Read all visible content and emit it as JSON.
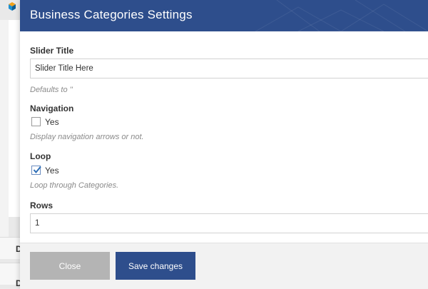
{
  "background": {
    "letters": [
      "D",
      "D"
    ]
  },
  "modal": {
    "title": "Business Categories Settings",
    "fields": {
      "slider_title": {
        "label": "Slider Title",
        "value": "Slider Title Here",
        "help": "Defaults to ''"
      },
      "navigation": {
        "label": "Navigation",
        "checkbox_label": "Yes",
        "checked": false,
        "help": "Display navigation arrows or not."
      },
      "loop": {
        "label": "Loop",
        "checkbox_label": "Yes",
        "checked": true,
        "help": "Loop through Categories."
      },
      "rows": {
        "label": "Rows",
        "value": "1"
      }
    },
    "footer": {
      "close_label": "Close",
      "save_label": "Save changes"
    }
  },
  "colors": {
    "header": "#2e4e8c",
    "primary_button": "#2e4e8c",
    "secondary_button": "#b4b4b4",
    "checkbox_checked": "#2e6fb7"
  }
}
